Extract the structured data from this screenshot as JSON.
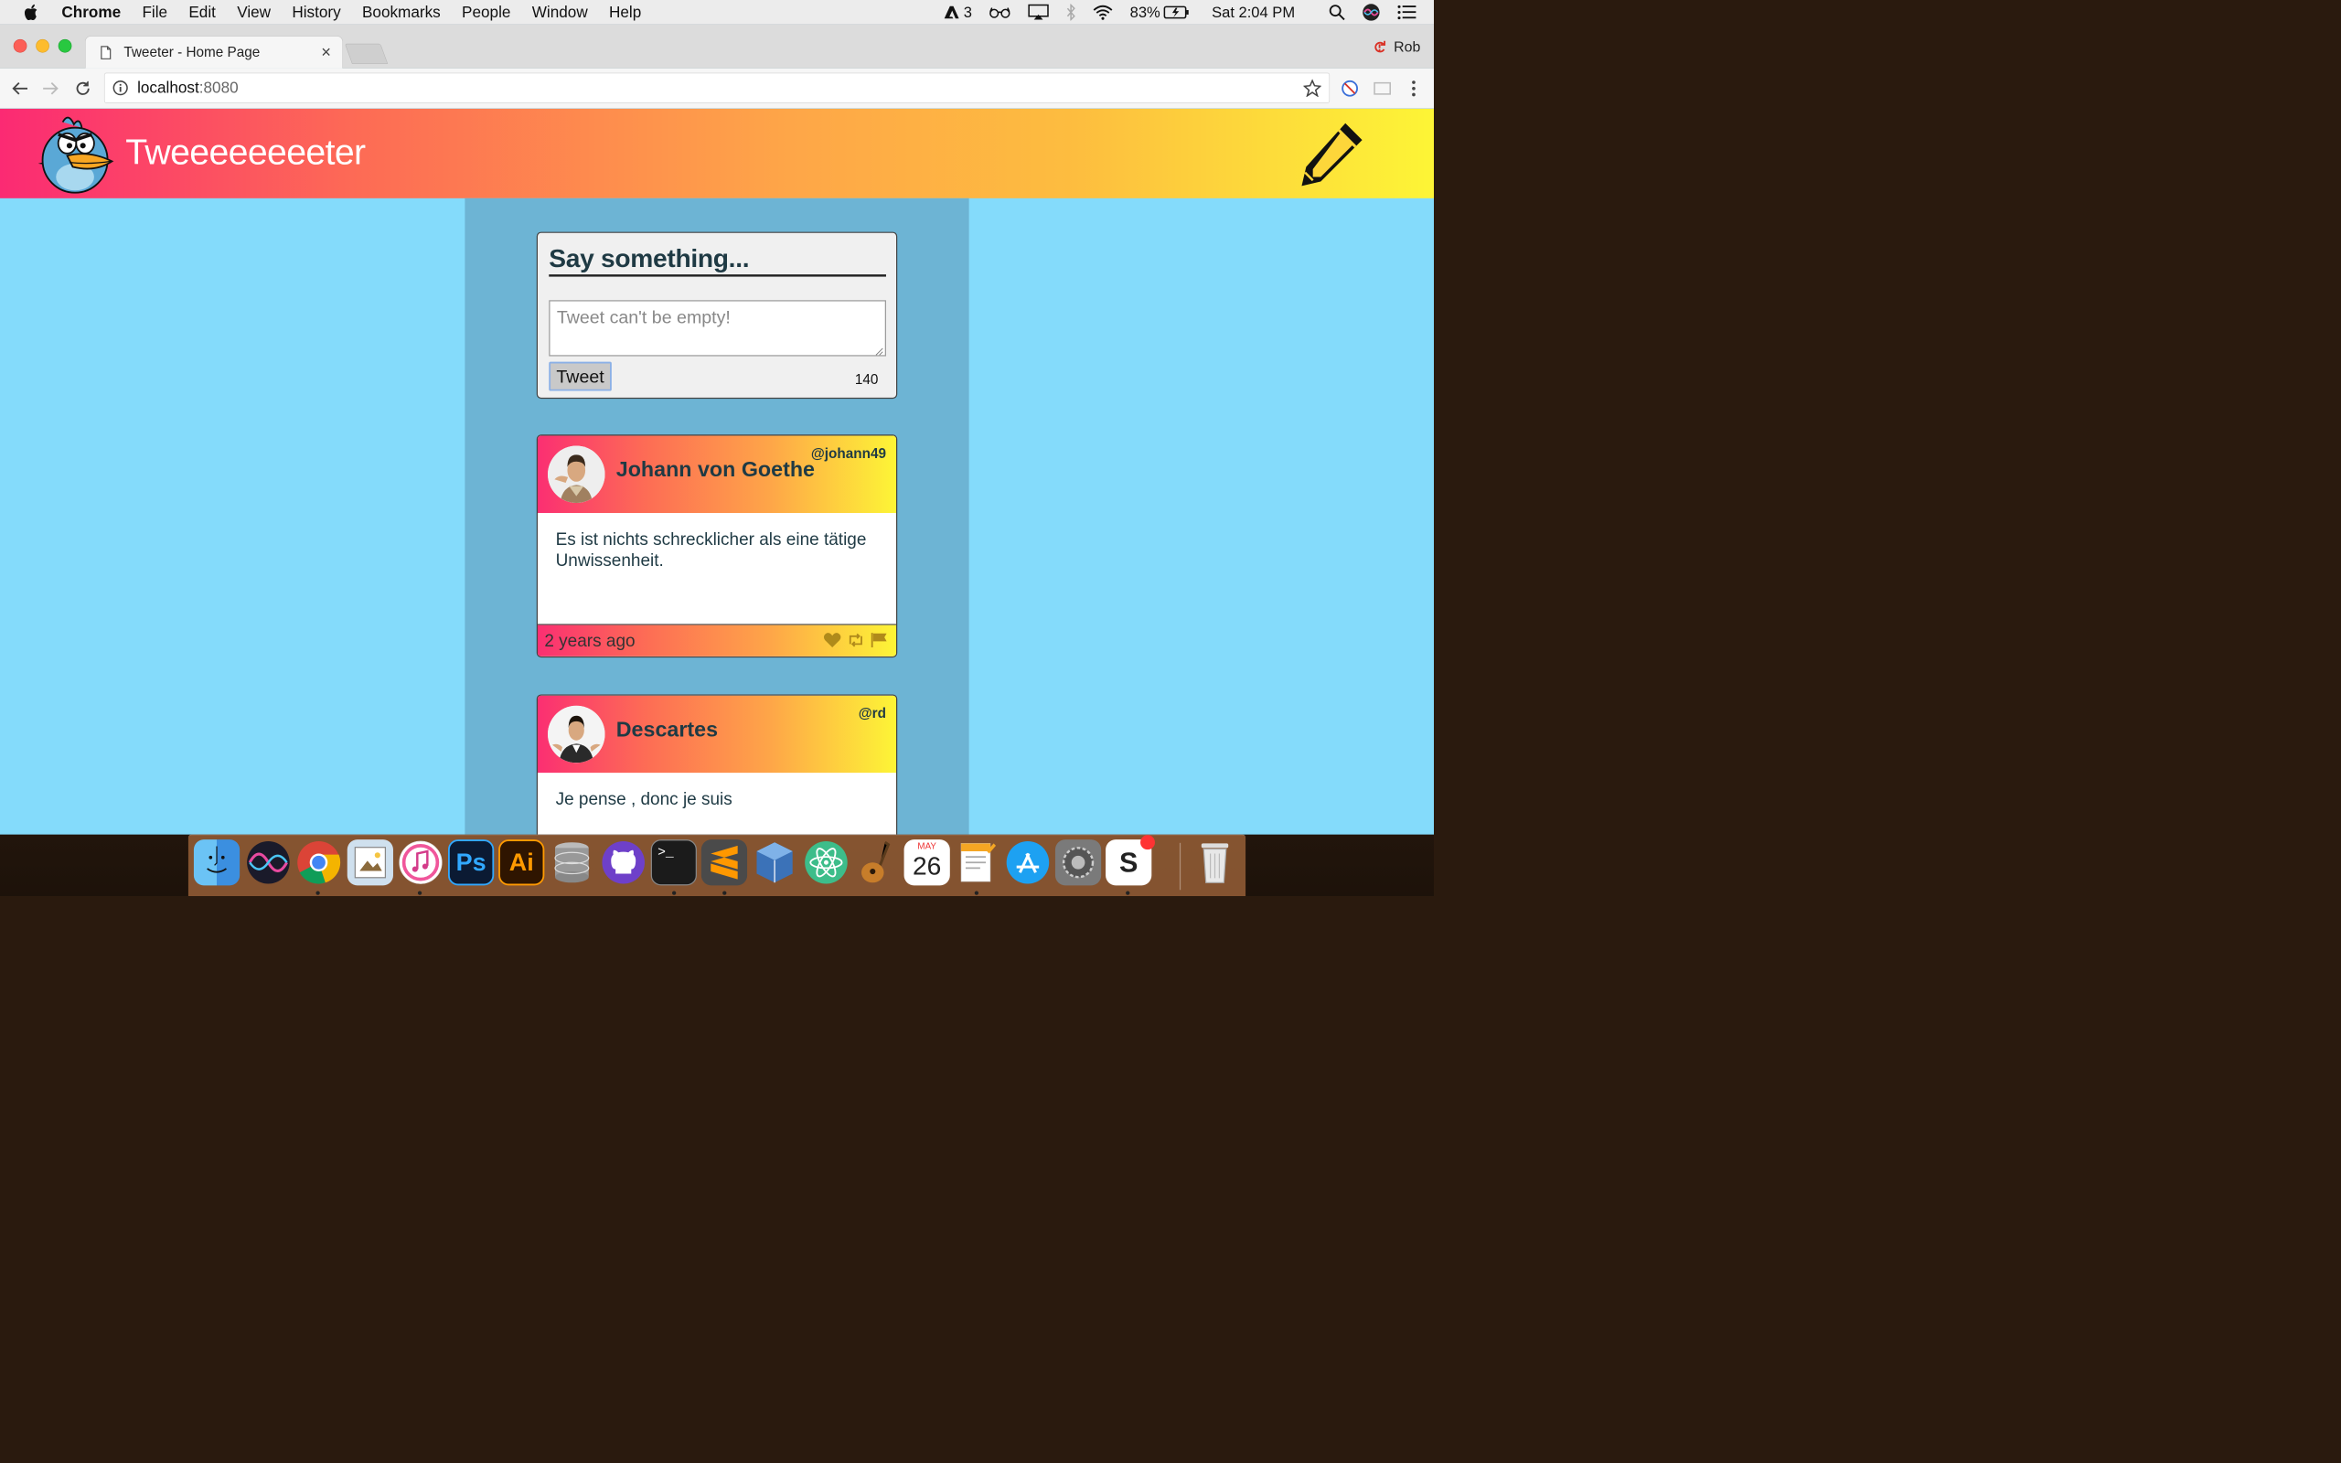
{
  "menubar": {
    "app_name": "Chrome",
    "items": [
      "File",
      "Edit",
      "View",
      "History",
      "Bookmarks",
      "People",
      "Window",
      "Help"
    ],
    "adobe_count": "3",
    "battery": "83%",
    "clock": "Sat 2:04 PM"
  },
  "browser": {
    "tab_title": "Tweeter - Home Page",
    "tab_close": "×",
    "profile_name": "Rob",
    "url_host": "localhost",
    "url_port": ":8080"
  },
  "site": {
    "title": "Tweeeeeeeeter"
  },
  "composer": {
    "heading": "Say something...",
    "placeholder": "Tweet can't be empty!",
    "button_label": "Tweet",
    "char_count": "140"
  },
  "tweets": [
    {
      "name": "Johann von Goethe",
      "handle": "@johann49",
      "text": "Es ist nichts schrecklicher als eine tätige Unwissenheit.",
      "age": "2 years ago"
    },
    {
      "name": "Descartes",
      "handle": "@rd",
      "text": "Je pense , donc je suis"
    }
  ],
  "dock": {
    "calendar_month": "MAY",
    "calendar_day": "26",
    "apps": [
      "finder",
      "siri",
      "chrome",
      "preview",
      "itunes",
      "photoshop",
      "illustrator",
      "database",
      "github",
      "terminal",
      "sublime-text",
      "virtualbox",
      "atom",
      "garageband",
      "calendar",
      "pages",
      "app-store",
      "system-preferences",
      "slack",
      "trash"
    ]
  },
  "colors": {
    "page_bg": "#84dbfb",
    "column_bg": "#6db4d4",
    "header_gradient_start": "#fb2a73",
    "header_gradient_end": "#fdf536",
    "text_dark": "#1f3a44"
  }
}
